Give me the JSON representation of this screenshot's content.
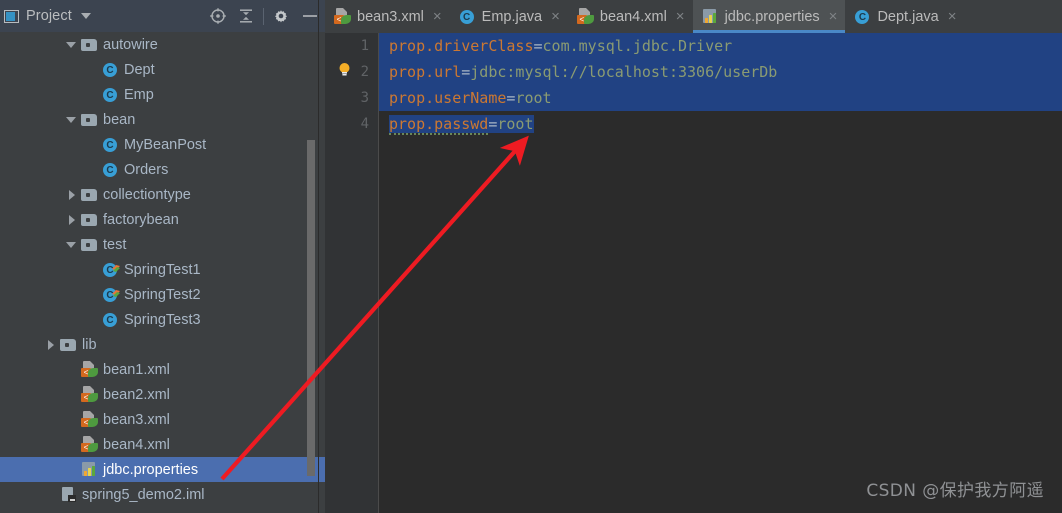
{
  "window": {
    "panel_title": "Project",
    "panel_caret": "dropdown-caret"
  },
  "toolbar": {
    "icons": [
      {
        "name": "locate-target-icon",
        "label": "Select Opened File"
      },
      {
        "name": "collapse-all-icon",
        "label": "Collapse All"
      },
      {
        "name": "gear-icon",
        "label": "Settings"
      },
      {
        "name": "minimize-icon",
        "label": "Hide"
      }
    ]
  },
  "tree": {
    "items": [
      {
        "label": "autowire",
        "icon": "folder-icon",
        "indent": 2,
        "arrow": "open",
        "selected": false
      },
      {
        "label": "Dept",
        "icon": "class-icon",
        "indent": 3,
        "arrow": "none",
        "selected": false
      },
      {
        "label": "Emp",
        "icon": "class-icon",
        "indent": 3,
        "arrow": "none",
        "selected": false
      },
      {
        "label": "bean",
        "icon": "folder-icon",
        "indent": 2,
        "arrow": "open",
        "selected": false
      },
      {
        "label": "MyBeanPost",
        "icon": "class-icon",
        "indent": 3,
        "arrow": "none",
        "selected": false
      },
      {
        "label": "Orders",
        "icon": "class-icon",
        "indent": 3,
        "arrow": "none",
        "selected": false
      },
      {
        "label": "collectiontype",
        "icon": "folder-icon",
        "indent": 2,
        "arrow": "closed",
        "selected": false
      },
      {
        "label": "factorybean",
        "icon": "folder-icon",
        "indent": 2,
        "arrow": "closed",
        "selected": false
      },
      {
        "label": "test",
        "icon": "folder-icon",
        "indent": 2,
        "arrow": "open",
        "selected": false
      },
      {
        "label": "SpringTest1",
        "icon": "class-runnable-icon",
        "indent": 3,
        "arrow": "none",
        "selected": false
      },
      {
        "label": "SpringTest2",
        "icon": "class-runnable-icon",
        "indent": 3,
        "arrow": "none",
        "selected": false
      },
      {
        "label": "SpringTest3",
        "icon": "class-icon",
        "indent": 3,
        "arrow": "none",
        "selected": false
      },
      {
        "label": "lib",
        "icon": "folder-icon",
        "indent": 1,
        "arrow": "closed",
        "selected": false
      },
      {
        "label": "bean1.xml",
        "icon": "spring-xml-icon",
        "indent": 2,
        "arrow": "none",
        "selected": false
      },
      {
        "label": "bean2.xml",
        "icon": "spring-xml-icon",
        "indent": 2,
        "arrow": "none",
        "selected": false
      },
      {
        "label": "bean3.xml",
        "icon": "spring-xml-icon",
        "indent": 2,
        "arrow": "none",
        "selected": false
      },
      {
        "label": "bean4.xml",
        "icon": "spring-xml-icon",
        "indent": 2,
        "arrow": "none",
        "selected": false
      },
      {
        "label": "jdbc.properties",
        "icon": "properties-icon",
        "indent": 2,
        "arrow": "none",
        "selected": true
      },
      {
        "label": "spring5_demo2.iml",
        "icon": "iml-icon",
        "indent": 1,
        "arrow": "none",
        "selected": false
      }
    ]
  },
  "tabs": [
    {
      "label": "bean3.xml",
      "icon": "spring-xml-icon",
      "active": false,
      "close": "×"
    },
    {
      "label": "Emp.java",
      "icon": "class-icon",
      "active": false,
      "close": "×"
    },
    {
      "label": "bean4.xml",
      "icon": "spring-xml-icon",
      "active": false,
      "close": "×"
    },
    {
      "label": "jdbc.properties",
      "icon": "properties-icon",
      "active": true,
      "close": "×"
    },
    {
      "label": "Dept.java",
      "icon": "class-icon",
      "active": false,
      "close": "×"
    }
  ],
  "editor": {
    "file": "jdbc.properties",
    "gutter": [
      "1",
      "2",
      "3",
      "4"
    ],
    "lines": [
      {
        "key": "prop.driverClass",
        "eq": "=",
        "value": "com.mysql.jdbc.Driver",
        "selected_full": true,
        "warn": false
      },
      {
        "key": "prop.url",
        "eq": "=",
        "value": "jdbc:mysql://localhost:3306/userDb",
        "selected_full": true,
        "warn": false
      },
      {
        "key": "prop.userName",
        "eq": "=",
        "value": "root",
        "selected_full": true,
        "warn": false
      },
      {
        "key": "prop.passwd",
        "eq": "=",
        "value": "root",
        "selected_full": false,
        "warn": true
      }
    ],
    "intention_bulb": "lightbulb-icon"
  },
  "annotation": {
    "arrow": "red-arrow-pointer",
    "color": "#ee1b22",
    "from": "jdbc.properties tree node",
    "to": "end of line 4"
  },
  "watermark": {
    "text": "CSDN @保护我方阿遥"
  },
  "colors": {
    "panel_bg": "#3c3f41",
    "header_bg": "#3c4450",
    "editor_bg": "#2b2b2b",
    "gutter_bg": "#313335",
    "selection_blue": "#214283",
    "tree_selection": "#4b6eaf",
    "tab_active": "#4e5254",
    "tab_underline": "#4a88c7",
    "key_orange": "#cc7832",
    "value_green": "#8a9b72",
    "text": "#a9b7c6",
    "arrow_red": "#ee1b22"
  }
}
